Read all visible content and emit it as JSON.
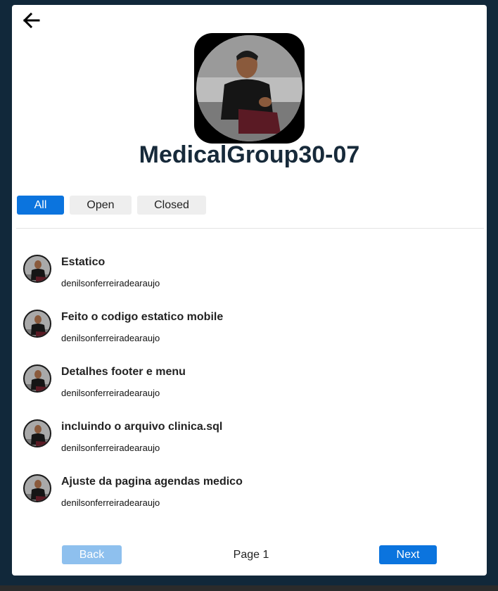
{
  "header": {
    "back_icon": "arrow-left-icon",
    "group_name": "MedicalGroup30-07"
  },
  "tabs": [
    {
      "label": "All",
      "active": true
    },
    {
      "label": "Open",
      "active": false
    },
    {
      "label": "Closed",
      "active": false
    }
  ],
  "items": [
    {
      "title": "Estatico",
      "author": "denilsonferreiradearaujo"
    },
    {
      "title": "Feito o codigo estatico mobile",
      "author": "denilsonferreiradearaujo"
    },
    {
      "title": "Detalhes footer e menu",
      "author": "denilsonferreiradearaujo"
    },
    {
      "title": "incluindo o arquivo clinica.sql",
      "author": "denilsonferreiradearaujo"
    },
    {
      "title": "Ajuste da pagina agendas medico",
      "author": "denilsonferreiradearaujo"
    }
  ],
  "pagination": {
    "back_label": "Back",
    "page_label": "Page 1",
    "next_label": "Next"
  },
  "colors": {
    "page_background": "#11283a",
    "accent": "#0b74de",
    "accent_disabled": "#8ec0ee",
    "title_text": "#172a3a"
  }
}
